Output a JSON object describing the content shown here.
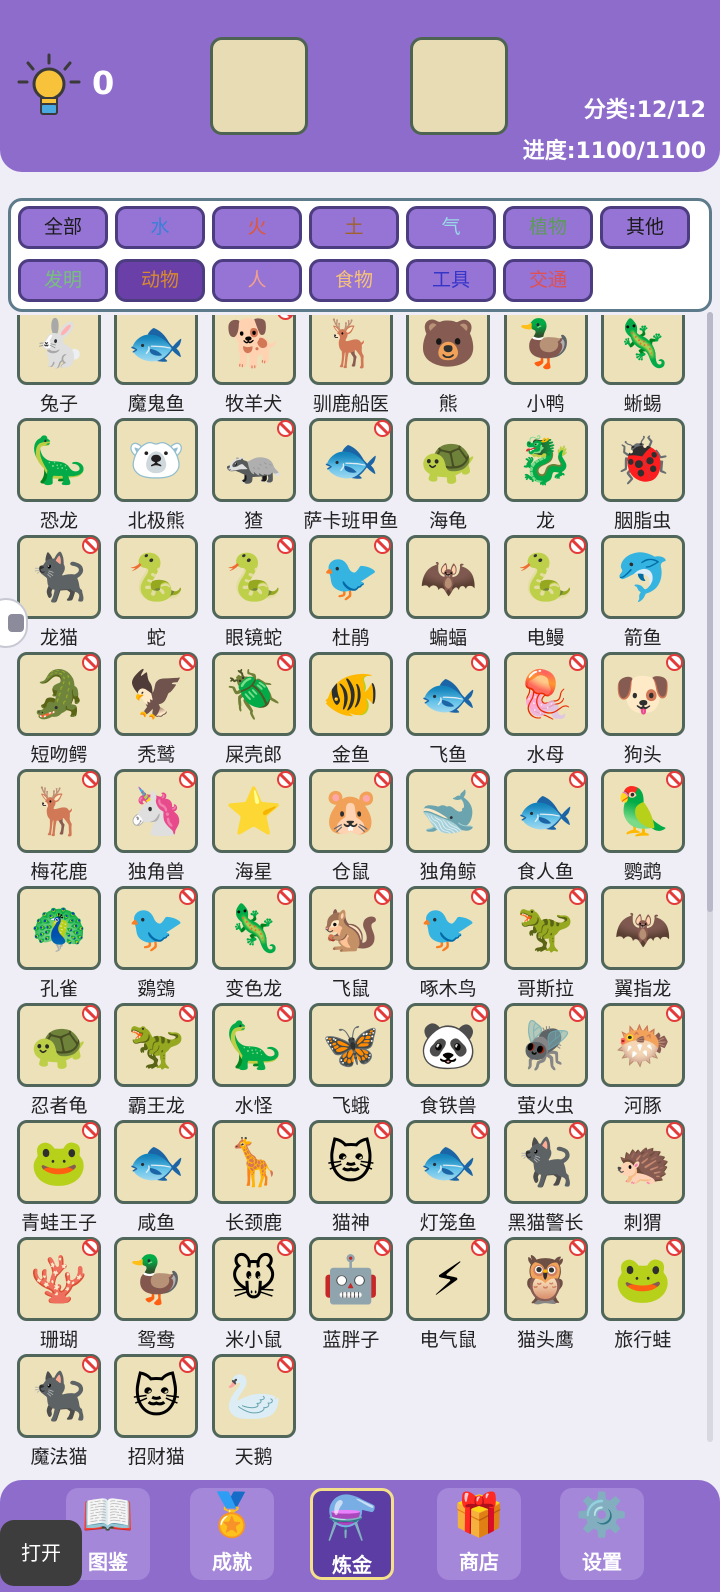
{
  "header": {
    "hint_count": "0",
    "category_progress": "分类:12/12",
    "progress": "进度:1100/1100"
  },
  "filters": [
    {
      "label": "全部",
      "color": "#1a1a1a",
      "active": false
    },
    {
      "label": "水",
      "color": "#3b7fd8",
      "active": false
    },
    {
      "label": "火",
      "color": "#e05636",
      "active": false
    },
    {
      "label": "土",
      "color": "#a0622c",
      "active": false
    },
    {
      "label": "气",
      "color": "#9ad8e8",
      "active": false
    },
    {
      "label": "植物",
      "color": "#5c9a58",
      "active": false
    },
    {
      "label": "其他",
      "color": "#1a1a1a",
      "active": false
    },
    {
      "label": "发明",
      "color": "#76c07a",
      "active": false
    },
    {
      "label": "动物",
      "color": "#d98a2e",
      "active": true
    },
    {
      "label": "人",
      "color": "#f0a08c",
      "active": false
    },
    {
      "label": "食物",
      "color": "#f7c27a",
      "active": false
    },
    {
      "label": "工具",
      "color": "#3535c8",
      "active": false
    },
    {
      "label": "交通",
      "color": "#e05050",
      "active": false
    }
  ],
  "items": [
    {
      "name": "兔子",
      "icon": "🐇",
      "banned": false
    },
    {
      "name": "魔鬼鱼",
      "icon": "🐟",
      "banned": false
    },
    {
      "name": "牧羊犬",
      "icon": "🐕",
      "banned": true
    },
    {
      "name": "驯鹿船医",
      "icon": "🦌",
      "banned": false
    },
    {
      "name": "熊",
      "icon": "🐻",
      "banned": false
    },
    {
      "name": "小鸭",
      "icon": "🦆",
      "banned": false
    },
    {
      "name": "蜥蜴",
      "icon": "🦎",
      "banned": false
    },
    {
      "name": "恐龙",
      "icon": "🦕",
      "banned": false
    },
    {
      "name": "北极熊",
      "icon": "🐻‍❄️",
      "banned": false
    },
    {
      "name": "猹",
      "icon": "🦡",
      "banned": true
    },
    {
      "name": "萨卡班甲鱼",
      "icon": "🐟",
      "banned": true
    },
    {
      "name": "海龟",
      "icon": "🐢",
      "banned": false
    },
    {
      "name": "龙",
      "icon": "🐉",
      "banned": false
    },
    {
      "name": "胭脂虫",
      "icon": "🐞",
      "banned": false
    },
    {
      "name": "龙猫",
      "icon": "🐈‍⬛",
      "banned": true
    },
    {
      "name": "蛇",
      "icon": "🐍",
      "banned": false
    },
    {
      "name": "眼镜蛇",
      "icon": "🐍",
      "banned": true
    },
    {
      "name": "杜鹃",
      "icon": "🐦",
      "banned": true
    },
    {
      "name": "蝙蝠",
      "icon": "🦇",
      "banned": false
    },
    {
      "name": "电鳗",
      "icon": "🐍",
      "banned": true
    },
    {
      "name": "箭鱼",
      "icon": "🐬",
      "banned": false
    },
    {
      "name": "短吻鳄",
      "icon": "🐊",
      "banned": true
    },
    {
      "name": "秃鹫",
      "icon": "🦅",
      "banned": true
    },
    {
      "name": "屎壳郎",
      "icon": "🪲",
      "banned": true
    },
    {
      "name": "金鱼",
      "icon": "🐠",
      "banned": false
    },
    {
      "name": "飞鱼",
      "icon": "🐟",
      "banned": true
    },
    {
      "name": "水母",
      "icon": "🪼",
      "banned": true
    },
    {
      "name": "狗头",
      "icon": "🐶",
      "banned": true
    },
    {
      "name": "梅花鹿",
      "icon": "🦌",
      "banned": true
    },
    {
      "name": "独角兽",
      "icon": "🦄",
      "banned": true
    },
    {
      "name": "海星",
      "icon": "⭐",
      "banned": true
    },
    {
      "name": "仓鼠",
      "icon": "🐹",
      "banned": true
    },
    {
      "name": "独角鲸",
      "icon": "🐋",
      "banned": true
    },
    {
      "name": "食人鱼",
      "icon": "🐟",
      "banned": true
    },
    {
      "name": "鹦鹉",
      "icon": "🦜",
      "banned": true
    },
    {
      "name": "孔雀",
      "icon": "🦚",
      "banned": false
    },
    {
      "name": "鵎鵼",
      "icon": "🐦",
      "banned": true
    },
    {
      "name": "变色龙",
      "icon": "🦎",
      "banned": true
    },
    {
      "name": "飞鼠",
      "icon": "🐿️",
      "banned": true
    },
    {
      "name": "啄木鸟",
      "icon": "🐦",
      "banned": true
    },
    {
      "name": "哥斯拉",
      "icon": "🦖",
      "banned": true
    },
    {
      "name": "翼指龙",
      "icon": "🦇",
      "banned": true
    },
    {
      "name": "忍者龟",
      "icon": "🐢",
      "banned": true
    },
    {
      "name": "霸王龙",
      "icon": "🦖",
      "banned": true
    },
    {
      "name": "水怪",
      "icon": "🦕",
      "banned": true
    },
    {
      "name": "飞蛾",
      "icon": "🦋",
      "banned": true
    },
    {
      "name": "食铁兽",
      "icon": "🐼",
      "banned": true
    },
    {
      "name": "萤火虫",
      "icon": "🪰",
      "banned": true
    },
    {
      "name": "河豚",
      "icon": "🐡",
      "banned": true
    },
    {
      "name": "青蛙王子",
      "icon": "🐸",
      "banned": true
    },
    {
      "name": "咸鱼",
      "icon": "🐟",
      "banned": true
    },
    {
      "name": "长颈鹿",
      "icon": "🦒",
      "banned": true
    },
    {
      "name": "猫神",
      "icon": "🐱",
      "banned": true
    },
    {
      "name": "灯笼鱼",
      "icon": "🐟",
      "banned": true
    },
    {
      "name": "黑猫警长",
      "icon": "🐈‍⬛",
      "banned": true
    },
    {
      "name": "刺猬",
      "icon": "🦔",
      "banned": true
    },
    {
      "name": "珊瑚",
      "icon": "🪸",
      "banned": true
    },
    {
      "name": "鸳鸯",
      "icon": "🦆",
      "banned": true
    },
    {
      "name": "米小鼠",
      "icon": "🐭",
      "banned": true
    },
    {
      "name": "蓝胖子",
      "icon": "🤖",
      "banned": true
    },
    {
      "name": "电气鼠",
      "icon": "⚡",
      "banned": true
    },
    {
      "name": "猫头鹰",
      "icon": "🦉",
      "banned": true
    },
    {
      "name": "旅行蛙",
      "icon": "🐸",
      "banned": true
    },
    {
      "name": "魔法猫",
      "icon": "🐈‍⬛",
      "banned": true
    },
    {
      "name": "招财猫",
      "icon": "🐱",
      "banned": true
    },
    {
      "name": "天鹅",
      "icon": "🦢",
      "banned": true
    }
  ],
  "nav": [
    {
      "label": "图鉴",
      "icon": "📖",
      "active": false
    },
    {
      "label": "成就",
      "icon": "🏅",
      "active": false
    },
    {
      "label": "炼金",
      "icon": "⚗️",
      "active": true
    },
    {
      "label": "商店",
      "icon": "🎁",
      "active": false
    },
    {
      "label": "设置",
      "icon": "⚙️",
      "active": false
    }
  ],
  "open_button": "打开"
}
